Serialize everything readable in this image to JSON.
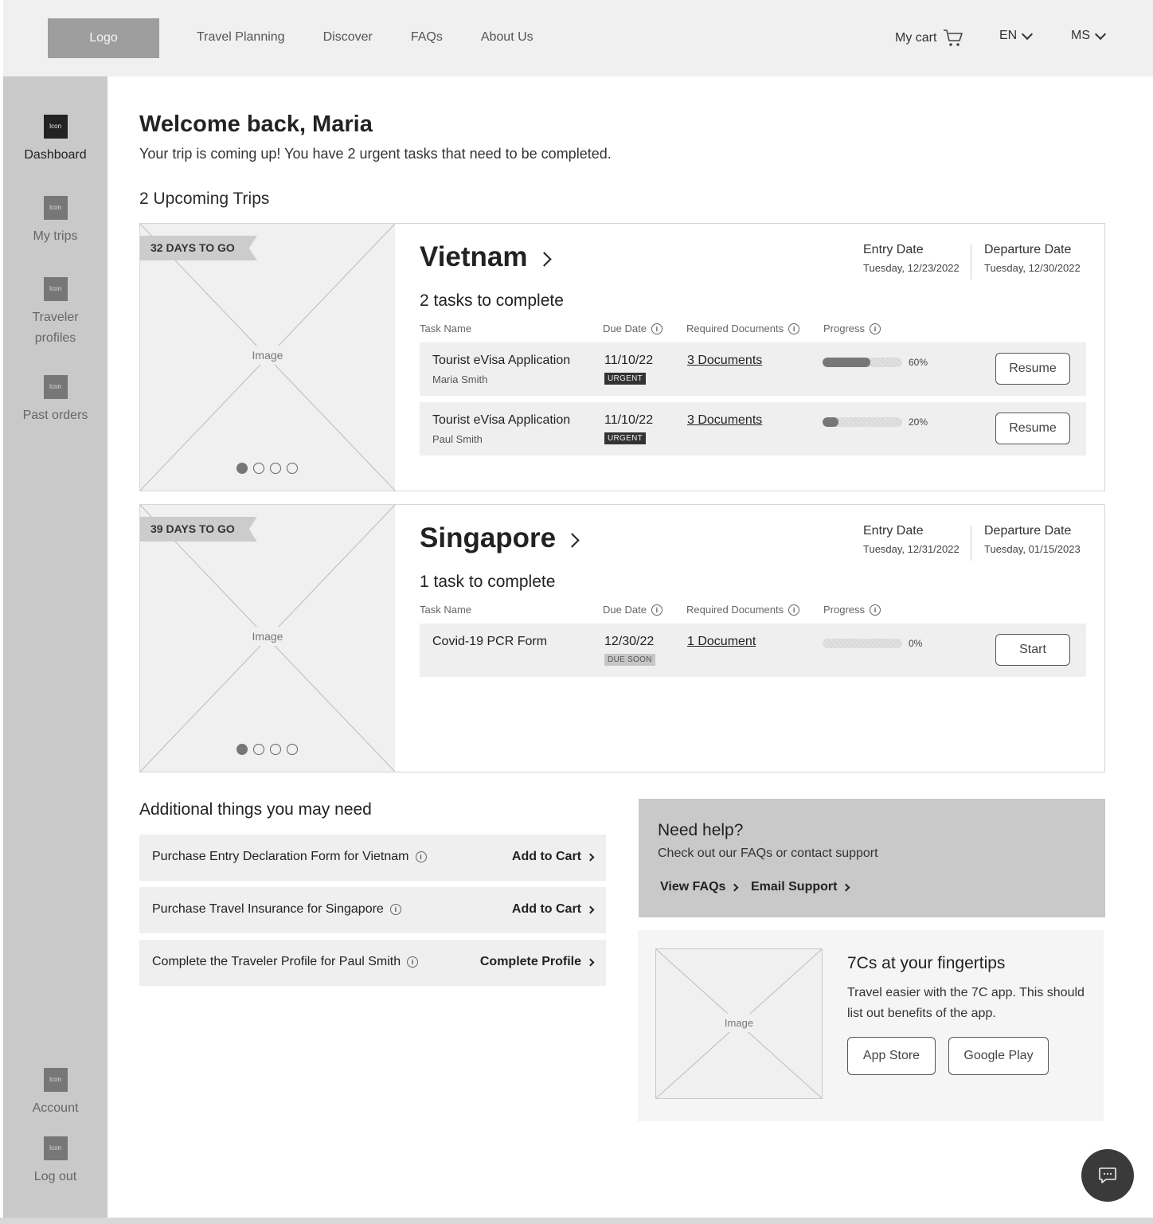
{
  "header": {
    "logo": "Logo",
    "nav": [
      "Travel Planning",
      "Discover",
      "FAQs",
      "About Us"
    ],
    "cart_label": "My cart",
    "language": "EN",
    "user_initials": "MS"
  },
  "sidebar": {
    "icon_text": "Icon",
    "items": [
      {
        "label": "Dashboard",
        "active": true
      },
      {
        "label": "My trips"
      },
      {
        "label": "Traveler profiles"
      },
      {
        "label": "Past orders"
      }
    ],
    "bottom": [
      {
        "label": "Account"
      },
      {
        "label": "Log out"
      }
    ]
  },
  "main": {
    "welcome": "Welcome back, Maria",
    "subtitle": "Your trip is coming up!  You have 2 urgent tasks that need to be completed.",
    "upcoming_title": "2 Upcoming Trips",
    "image_label": "Image",
    "columns": {
      "task": "Task Name",
      "due": "Due Date",
      "docs": "Required Documents",
      "progress": "Progress"
    },
    "trips": [
      {
        "countdown": "32 DAYS TO GO",
        "destination": "Vietnam",
        "entry_label": "Entry Date",
        "entry_date": "Tuesday, 12/23/2022",
        "departure_label": "Departure Date",
        "departure_date": "Tuesday, 12/30/2022",
        "tasks_title": "2 tasks to complete",
        "tasks": [
          {
            "name": "Tourist eVisa Application",
            "person": "Maria Smith",
            "due": "11/10/22",
            "badge": "URGENT",
            "docs": "3 Documents",
            "progress": 60,
            "progress_label": "60%",
            "action": "Resume"
          },
          {
            "name": "Tourist eVisa Application",
            "person": "Paul Smith",
            "due": "11/10/22",
            "badge": "URGENT",
            "docs": "3 Documents",
            "progress": 20,
            "progress_label": "20%",
            "action": "Resume"
          }
        ]
      },
      {
        "countdown": "39 DAYS TO GO",
        "destination": "Singapore",
        "entry_label": "Entry Date",
        "entry_date": "Tuesday, 12/31/2022",
        "departure_label": "Departure Date",
        "departure_date": "Tuesday, 01/15/2023",
        "tasks_title": "1 task to complete",
        "tasks": [
          {
            "name": "Covid-19 PCR Form",
            "person": "",
            "due": "12/30/22",
            "badge": "DUE SOON",
            "docs": "1 Document",
            "progress": 0,
            "progress_label": "0%",
            "action": "Start"
          }
        ]
      }
    ]
  },
  "additional": {
    "title": "Additional things you may need",
    "items": [
      {
        "text": "Purchase Entry Declaration Form for Vietnam",
        "action": "Add to Cart"
      },
      {
        "text": "Purchase Travel Insurance for Singapore",
        "action": "Add to Cart"
      },
      {
        "text": "Complete the Traveler Profile for Paul Smith",
        "action": "Complete Profile"
      }
    ]
  },
  "help": {
    "title": "Need help?",
    "subtitle": "Check out our FAQs or contact support",
    "faq_link": "View FAQs",
    "email_link": "Email Support"
  },
  "app_promo": {
    "image_label": "Image",
    "title": "7Cs at your fingertips",
    "description": "Travel easier with the 7C app. This should list out benefits of the app.",
    "app_store": "App Store",
    "google_play": "Google Play"
  },
  "icons": {
    "cart": "cart-icon",
    "chat": "chat-icon",
    "info": "info-icon"
  }
}
